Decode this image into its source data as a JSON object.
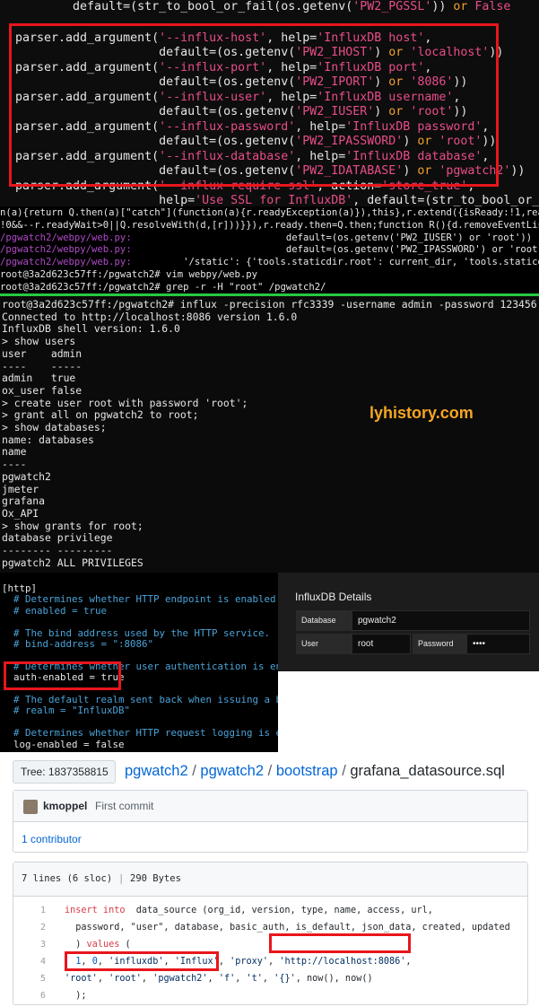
{
  "panel1": {
    "lines": [
      [
        [
          "k-def",
          "        default=(str_to_bool_or_fail(os.getenv("
        ],
        [
          "k-str",
          "'PW2_PGSSL'"
        ],
        [
          "k-def",
          ")) "
        ],
        [
          "k-kw",
          "or"
        ],
        [
          "k-def",
          " "
        ],
        [
          "k-str",
          "False"
        ]
      ],
      [
        [
          "k-def",
          "parser.add_argument("
        ],
        [
          "k-str",
          "'--influx-host'"
        ],
        [
          "k-def",
          ", help="
        ],
        [
          "k-str",
          "'InfluxDB host'"
        ],
        [
          "k-def",
          ","
        ]
      ],
      [
        [
          "k-def",
          "                    default=(os.getenv("
        ],
        [
          "k-str",
          "'PW2_IHOST'"
        ],
        [
          "k-def",
          ") "
        ],
        [
          "k-kw",
          "or"
        ],
        [
          "k-def",
          " "
        ],
        [
          "k-str",
          "'localhost'"
        ],
        [
          "k-def",
          "))"
        ]
      ],
      [
        [
          "k-def",
          "parser.add_argument("
        ],
        [
          "k-str",
          "'--influx-port'"
        ],
        [
          "k-def",
          ", help="
        ],
        [
          "k-str",
          "'InfluxDB port'"
        ],
        [
          "k-def",
          ","
        ]
      ],
      [
        [
          "k-def",
          "                    default=(os.getenv("
        ],
        [
          "k-str",
          "'PW2_IPORT'"
        ],
        [
          "k-def",
          ") "
        ],
        [
          "k-kw",
          "or"
        ],
        [
          "k-def",
          " "
        ],
        [
          "k-str",
          "'8086'"
        ],
        [
          "k-def",
          "))"
        ]
      ],
      [
        [
          "k-def",
          "parser.add_argument("
        ],
        [
          "k-str",
          "'--influx-user'"
        ],
        [
          "k-def",
          ", help="
        ],
        [
          "k-str",
          "'InfluxDB username'"
        ],
        [
          "k-def",
          ","
        ]
      ],
      [
        [
          "k-def",
          "                    default=(os.getenv("
        ],
        [
          "k-str",
          "'PW2_IUSER'"
        ],
        [
          "k-def",
          ") "
        ],
        [
          "k-kw",
          "or"
        ],
        [
          "k-def",
          " "
        ],
        [
          "k-str",
          "'root'"
        ],
        [
          "k-def",
          "))"
        ]
      ],
      [
        [
          "k-def",
          "parser.add_argument("
        ],
        [
          "k-str",
          "'--influx-password'"
        ],
        [
          "k-def",
          ", help="
        ],
        [
          "k-str",
          "'InfluxDB password'"
        ],
        [
          "k-def",
          ","
        ]
      ],
      [
        [
          "k-def",
          "                    default=(os.getenv("
        ],
        [
          "k-str",
          "'PW2_IPASSWORD'"
        ],
        [
          "k-def",
          ") "
        ],
        [
          "k-kw",
          "or"
        ],
        [
          "k-def",
          " "
        ],
        [
          "k-str",
          "'root'"
        ],
        [
          "k-def",
          "))"
        ]
      ],
      [
        [
          "k-def",
          "parser.add_argument("
        ],
        [
          "k-str",
          "'--influx-database'"
        ],
        [
          "k-def",
          ", help="
        ],
        [
          "k-str",
          "'InfluxDB database'"
        ],
        [
          "k-def",
          ","
        ]
      ],
      [
        [
          "k-def",
          "                    default=(os.getenv("
        ],
        [
          "k-str",
          "'PW2_IDATABASE'"
        ],
        [
          "k-def",
          ") "
        ],
        [
          "k-kw",
          "or"
        ],
        [
          "k-def",
          " "
        ],
        [
          "k-str",
          "'pgwatch2'"
        ],
        [
          "k-def",
          "))"
        ]
      ],
      [
        [
          "k-def",
          "parser.add_argument("
        ],
        [
          "k-str",
          "'--influx-require-ssl'"
        ],
        [
          "k-def",
          ", action="
        ],
        [
          "k-str",
          "'store_true'"
        ],
        [
          "k-def",
          ","
        ]
      ],
      [
        [
          "k-def",
          "                    help="
        ],
        [
          "k-str",
          "'Use SSL for InfluxDB'"
        ],
        [
          "k-def",
          ", default=(str_to_bool_or_fail(os."
        ]
      ]
    ]
  },
  "panel2": {
    "lines": [
      [
        [
          "",
          "n(a){return Q.then(a)[\"catch\"](function(a){r.readyException(a)}),this},r.extend({isReady:!1,readyWait:1"
        ]
      ],
      [
        [
          "",
          "!0&&--r.readyWait>0||Q.resolveWith(d,[r]))}}),r.ready.then=Q.then;function R(){d.removeEventListener(\"D"
        ]
      ],
      [
        [
          "purple",
          "/pgwatch2/webpy/web.py:"
        ],
        [
          "",
          "                           default=(os.getenv('PW2_IUSER') or 'root'))"
        ]
      ],
      [
        [
          "purple",
          "/pgwatch2/webpy/web.py:"
        ],
        [
          "",
          "                           default=(os.getenv('PW2_IPASSWORD') or 'root'))"
        ]
      ],
      [
        [
          "purple",
          "/pgwatch2/webpy/web.py:"
        ],
        [
          "",
          "         '/static': {'tools.staticdir.root': current_dir, 'tools.staticdir.dir':"
        ]
      ],
      [
        [
          "",
          "root@3a2d623c57ff:/pgwatch2# vim webpy/web.py"
        ]
      ],
      [
        [
          "",
          "root@3a2d623c57ff:/pgwatch2# grep -r -H \"root\" /pgwatch2/"
        ]
      ]
    ]
  },
  "panel3": {
    "lines": [
      "root@3a2d623c57ff:/pgwatch2# influx -precision rfc3339 -username admin -password 123456",
      "Connected to http://localhost:8086 version 1.6.0",
      "InfluxDB shell version: 1.6.0",
      "> show users",
      "user    admin",
      "----    -----",
      "admin   true",
      "ox_user false",
      "> create user root with password 'root';",
      "> grant all on pgwatch2 to root;",
      "> show databases;",
      "name: databases",
      "name",
      "----",
      "pgwatch2",
      "jmeter",
      "grafana",
      "Ox_API",
      "> show grants for root;",
      "database privilege",
      "-------- ---------",
      "pgwatch2 ALL PRIVILEGES"
    ],
    "watermark": "lyhistory.com"
  },
  "panel4": {
    "lines": [
      [
        [
          "",
          "[http]"
        ]
      ],
      [
        [
          "cfg-comment",
          "  # Determines whether HTTP endpoint is enabled."
        ]
      ],
      [
        [
          "cfg-comment",
          "  # enabled = true"
        ]
      ],
      [
        [
          "",
          ""
        ]
      ],
      [
        [
          "cfg-comment",
          "  # The bind address used by the HTTP service."
        ]
      ],
      [
        [
          "cfg-comment",
          "  # bind-address = \":8086\""
        ]
      ],
      [
        [
          "",
          ""
        ]
      ],
      [
        [
          "cfg-comment",
          "  # Determines whether user authentication is enabled"
        ]
      ],
      [
        [
          "",
          "  auth-enabled = true"
        ]
      ],
      [
        [
          "",
          ""
        ]
      ],
      [
        [
          "cfg-comment",
          "  # The default realm sent back when issuing a ba"
        ]
      ],
      [
        [
          "cfg-comment",
          "  # realm = \"InfluxDB\""
        ]
      ],
      [
        [
          "",
          ""
        ]
      ],
      [
        [
          "cfg-comment",
          "  # Determines whether HTTP request logging is en"
        ]
      ],
      [
        [
          "",
          "  log-enabled = false"
        ]
      ]
    ]
  },
  "influx_details": {
    "title": "InfluxDB Details",
    "database_label": "Database",
    "database_value": "pgwatch2",
    "user_label": "User",
    "user_value": "root",
    "password_label": "Password",
    "password_value": "••••"
  },
  "github": {
    "tree_button": "Tree: 1837358815 ▾",
    "breadcrumbs": [
      "pgwatch2",
      "pgwatch2",
      "bootstrap"
    ],
    "file_name": "grafana_datasource.sql",
    "commit_author": "kmoppel",
    "commit_message": "First commit",
    "contributors": "1 contributor",
    "file_lines_info": "7 lines (6 sloc)",
    "file_size": "290 Bytes",
    "code_lines": [
      {
        "n": "1",
        "parts": [
          [
            "c-kw",
            "insert into"
          ],
          [
            "",
            "  data_source (org_id, version, type, name, access, url,"
          ]
        ]
      },
      {
        "n": "2",
        "parts": [
          [
            "",
            "  password, \"user\", database, basic_auth, is_default, json_data, created, updated"
          ]
        ]
      },
      {
        "n": "3",
        "parts": [
          [
            "",
            "  ) "
          ],
          [
            "c-kw",
            "values"
          ],
          [
            "",
            " ("
          ]
        ]
      },
      {
        "n": "4",
        "parts": [
          [
            "",
            "  "
          ],
          [
            "c-num",
            "1"
          ],
          [
            "",
            ", "
          ],
          [
            "c-num",
            "0"
          ],
          [
            "",
            ", "
          ],
          [
            "c-str",
            "'influxdb'"
          ],
          [
            "",
            ", "
          ],
          [
            "c-str",
            "'Influx'"
          ],
          [
            "",
            ", "
          ],
          [
            "c-str",
            "'proxy'"
          ],
          [
            "",
            ", "
          ],
          [
            "c-str",
            "'http://localhost:8086'"
          ],
          [
            "",
            ","
          ]
        ]
      },
      {
        "n": "5",
        "parts": [
          [
            "c-str",
            "'root'"
          ],
          [
            "",
            ", "
          ],
          [
            "c-str",
            "'root'"
          ],
          [
            "",
            ", "
          ],
          [
            "c-str",
            "'pgwatch2'"
          ],
          [
            "",
            ", "
          ],
          [
            "c-str",
            "'f'"
          ],
          [
            "",
            ", "
          ],
          [
            "c-str",
            "'t'"
          ],
          [
            "",
            ", "
          ],
          [
            "c-str",
            "'{}'"
          ],
          [
            "",
            ", now(), now()"
          ]
        ]
      },
      {
        "n": "6",
        "parts": [
          [
            "",
            "  );"
          ]
        ]
      }
    ]
  },
  "colors": {
    "highlight": "#e8161b",
    "terminal_green_bar": "#27c93f",
    "watermark": "#f5a623",
    "link": "#0366d6"
  }
}
